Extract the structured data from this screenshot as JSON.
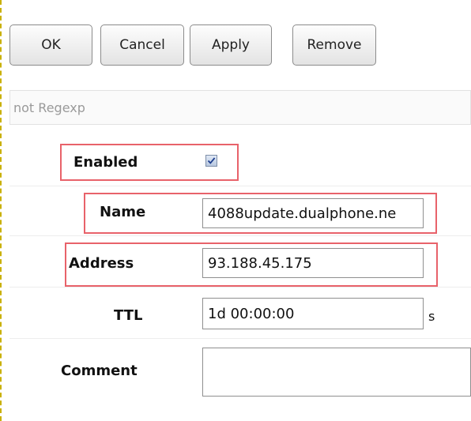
{
  "toolbar": {
    "ok_label": "OK",
    "cancel_label": "Cancel",
    "apply_label": "Apply",
    "remove_label": "Remove"
  },
  "filter_bar": {
    "text": "not Regexp"
  },
  "form": {
    "enabled": {
      "label": "Enabled",
      "checked": true
    },
    "name": {
      "label": "Name",
      "value": "4088update.dualphone.ne"
    },
    "address": {
      "label": "Address",
      "value": "93.188.45.175"
    },
    "ttl": {
      "label": "TTL",
      "value": "1d 00:00:00",
      "unit": "s"
    },
    "comment": {
      "label": "Comment",
      "value": ""
    }
  },
  "colors": {
    "highlight": "#e8626a",
    "page_border": "#c9b000"
  },
  "icons": {
    "checkbox": "checkmark-icon"
  }
}
